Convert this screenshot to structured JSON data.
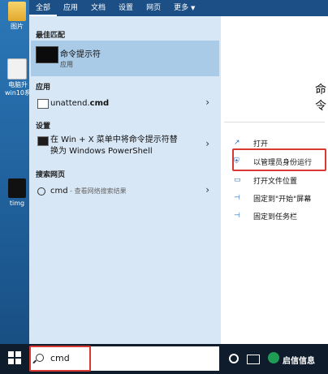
{
  "desktop": {
    "icons": [
      {
        "label": "图片",
        "kind": "folder"
      },
      {
        "label": "电脑升 win10系",
        "kind": "file"
      },
      {
        "label": "timg",
        "kind": "game"
      }
    ]
  },
  "tabs": [
    {
      "label": "全部",
      "active": true
    },
    {
      "label": "应用"
    },
    {
      "label": "文档"
    },
    {
      "label": "设置"
    },
    {
      "label": "网页"
    },
    {
      "label": "更多",
      "has_dropdown": true
    }
  ],
  "sections": {
    "best_match": "最佳匹配",
    "apps": "应用",
    "settings": "设置",
    "web": "搜索网页"
  },
  "best_match": {
    "title": "命令提示符",
    "subtitle": "应用",
    "icon": "terminal-icon"
  },
  "app_results": [
    {
      "pre": "unattend.",
      "bold": "cmd",
      "icon": "document-icon"
    }
  ],
  "setting_results": [
    {
      "line1": "在 Win + X 菜单中将命令提示符替",
      "line2": "换为 Windows PowerShell",
      "icon": "terminal-icon"
    }
  ],
  "web_results": [
    {
      "query": "cmd",
      "suffix": " - 查看网络搜索结果",
      "icon": "search-icon"
    }
  ],
  "detail": {
    "heading": "命令",
    "actions": [
      {
        "label": "打开",
        "icon": "open-icon"
      },
      {
        "label": "以管理员身份运行",
        "icon": "shield-run-icon",
        "highlighted": true
      },
      {
        "label": "打开文件位置",
        "icon": "folder-icon"
      },
      {
        "label": "固定到\"开始\"屏幕",
        "icon": "pin-icon"
      },
      {
        "label": "固定到任务栏",
        "icon": "pin-icon"
      }
    ]
  },
  "taskbar": {
    "search_value": "cmd",
    "watermark": "启信信息"
  },
  "colors": {
    "highlight_box": "#d63a32",
    "best_match_bg": "#a9cbe8",
    "menu_bg": "#d8e7f6",
    "tab_bar": "#1b4f86"
  }
}
